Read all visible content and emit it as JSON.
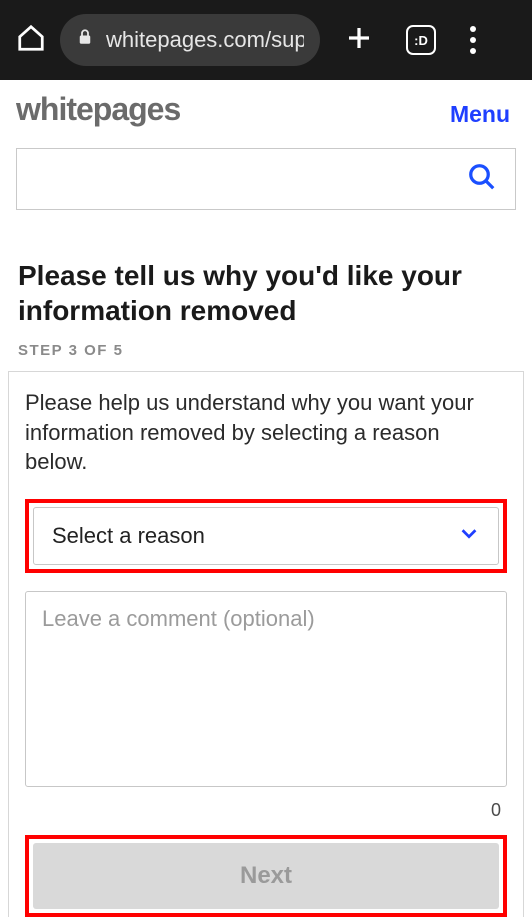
{
  "browser": {
    "url_display": "whitepages.com/supp",
    "tab_count": ":D"
  },
  "header": {
    "logo_text": "whitepages",
    "menu_label": "Menu"
  },
  "search": {
    "placeholder": ""
  },
  "title": {
    "heading": "Please tell us why you'd like your information removed",
    "step_label": "STEP 3 OF 5"
  },
  "form": {
    "intro": "Please help us understand why you want your information removed by selecting a reason below.",
    "select_placeholder": "Select a reason",
    "comment_placeholder": "Leave a comment (optional)",
    "char_count": "0",
    "next_label": "Next"
  },
  "colors": {
    "accent": "#1f3fff",
    "highlight": "#ff0000"
  }
}
